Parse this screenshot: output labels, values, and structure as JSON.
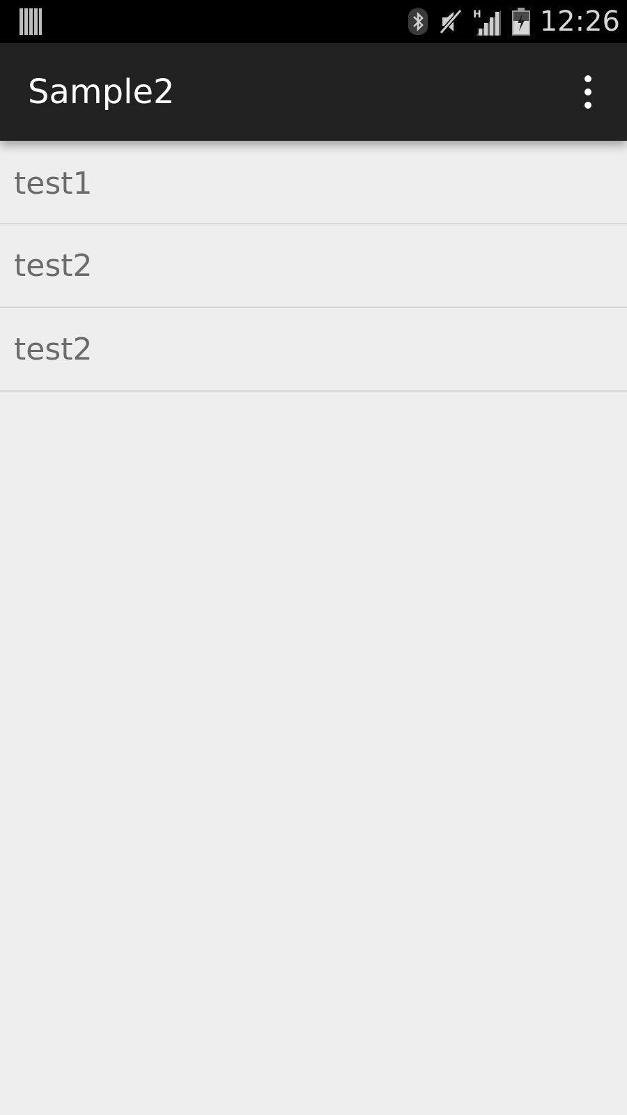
{
  "status_bar": {
    "notification_icon": "notification-bars-icon",
    "icons": [
      "bluetooth-icon",
      "muted-icon",
      "signal-h-icon",
      "battery-charging-icon"
    ],
    "time": "12:26"
  },
  "action_bar": {
    "title": "Sample2",
    "overflow_icon": "overflow-menu-icon"
  },
  "list": {
    "items": [
      {
        "label": "test1"
      },
      {
        "label": "test2"
      },
      {
        "label": "test2"
      }
    ]
  },
  "colors": {
    "status_bar": "#000000",
    "action_bar": "#212121",
    "background": "#eeeeee",
    "item_text": "#6b6b6b",
    "divider": "#d6d6d6"
  }
}
